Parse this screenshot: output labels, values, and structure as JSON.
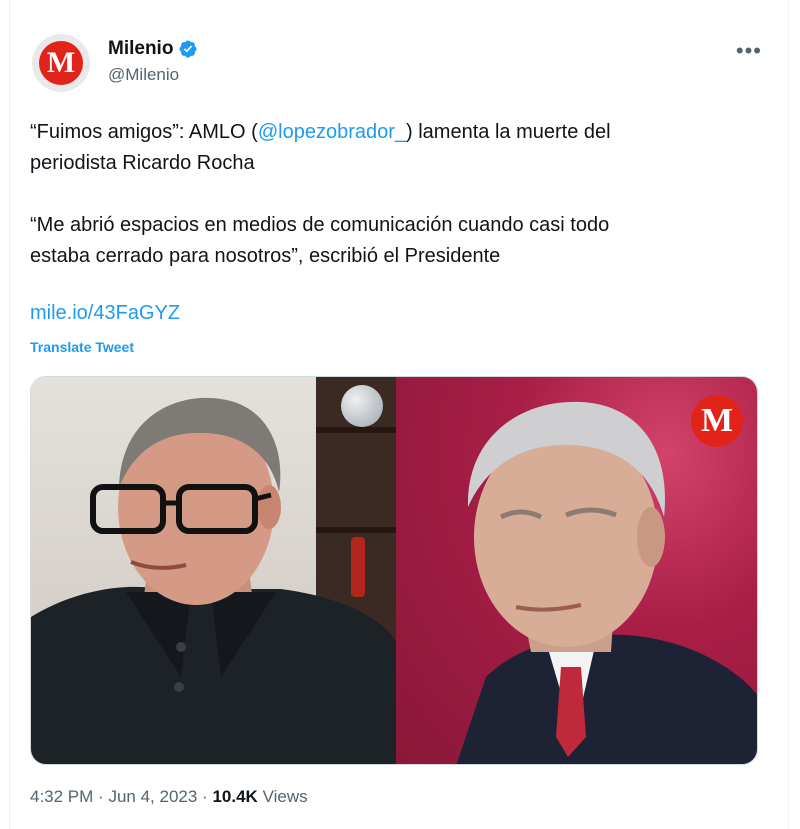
{
  "author": {
    "display_name": "Milenio",
    "handle": "@Milenio",
    "avatar_letter": "M",
    "verified_color": "#1d9bf0"
  },
  "tweet": {
    "line1_prefix": "“Fuimos amigos”: AMLO (",
    "mention": "@lopezobrador_",
    "line1_suffix": ") lamenta la muerte del",
    "line2": "periodista Ricardo Rocha",
    "quote_line1": "“Me abrió espacios en medios de comunicación cuando casi todo",
    "quote_line2": "estaba cerrado para nosotros”, escribió el Presidente",
    "link": "mile.io/43FaGYZ",
    "translate_label": "Translate Tweet"
  },
  "media": {
    "badge_letter": "M",
    "brand_color": "#e2231a"
  },
  "footer": {
    "time": "4:32 PM",
    "separator": "·",
    "date": "Jun 4, 2023",
    "views_count": "10.4K",
    "views_label": "Views"
  },
  "icons": {
    "more": "more-icon",
    "verified": "verified-badge-icon"
  },
  "colors": {
    "accent": "#1d9bf0",
    "text": "#0f1419",
    "muted": "#536471"
  }
}
